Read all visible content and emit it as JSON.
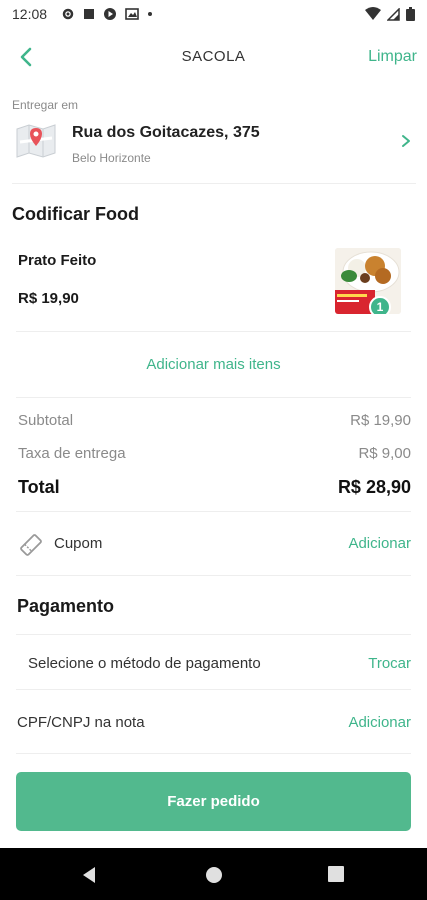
{
  "status_bar": {
    "time": "12:08"
  },
  "header": {
    "title": "SACOLA",
    "clear_label": "Limpar"
  },
  "delivery": {
    "label": "Entregar em",
    "street": "Rua dos Goitacazes, 375",
    "city": "Belo Horizonte"
  },
  "store": {
    "name": "Codificar Food"
  },
  "items": [
    {
      "name": "Prato Feito",
      "price": "R$ 19,90",
      "quantity": "1"
    }
  ],
  "add_more_label": "Adicionar mais itens",
  "summary": {
    "subtotal_label": "Subtotal",
    "subtotal_value": "R$ 19,90",
    "delivery_label": "Taxa de entrega",
    "delivery_value": "R$ 9,00",
    "total_label": "Total",
    "total_value": "R$ 28,90"
  },
  "coupon": {
    "label": "Cupom",
    "action": "Adicionar"
  },
  "payment": {
    "title": "Pagamento",
    "method_label": "Selecione o método de pagamento",
    "method_action": "Trocar"
  },
  "cpf": {
    "label": "CPF/CNPJ na nota",
    "action": "Adicionar"
  },
  "order_button": "Fazer pedido",
  "colors": {
    "accent": "#3fb58b",
    "button": "#52b98e",
    "muted": "#8a8a8a"
  },
  "icons": [
    "back-arrow-icon",
    "map-pin-icon",
    "chevron-right-icon",
    "coupon-icon",
    "settings-icon",
    "wifi-icon",
    "battery-icon"
  ]
}
